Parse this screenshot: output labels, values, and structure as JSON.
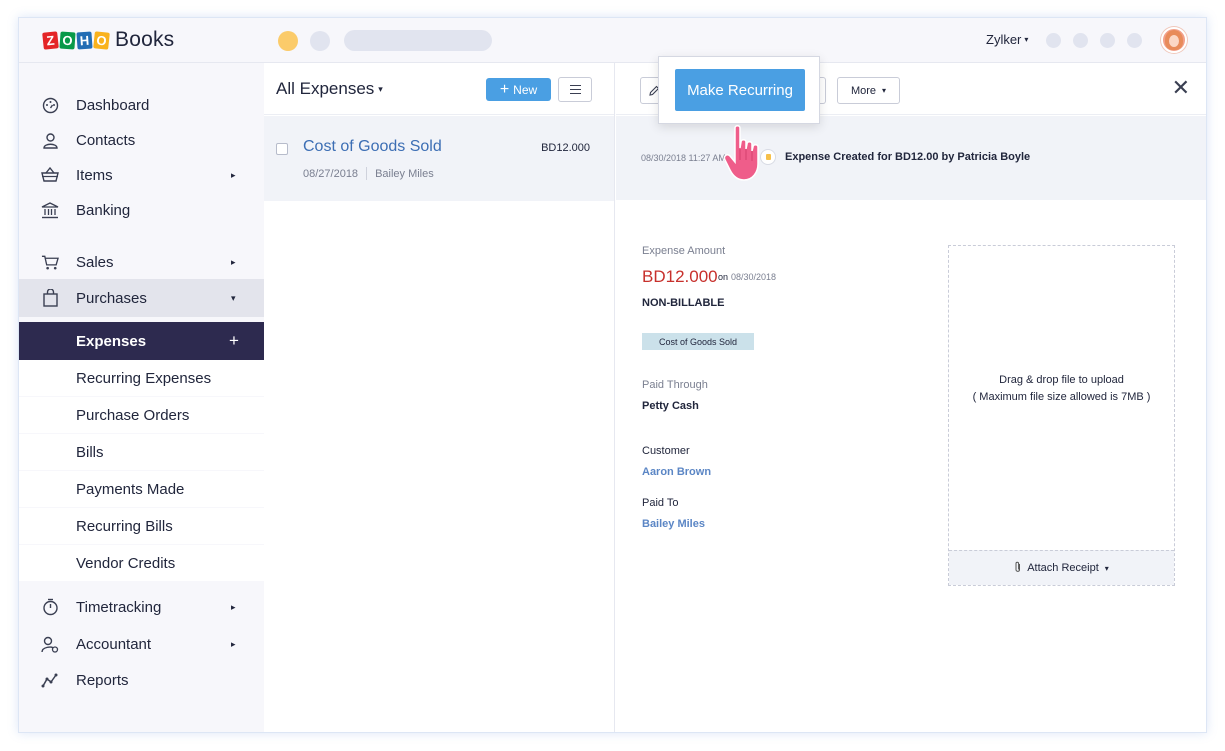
{
  "app": {
    "brand_tiles": [
      "Z",
      "O",
      "H",
      "O"
    ],
    "brand_name": "Books",
    "org_name": "Zylker",
    "org_caret": "▾"
  },
  "sidebar": {
    "items": [
      {
        "label": "Dashboard",
        "icon": "dashboard-icon"
      },
      {
        "label": "Contacts",
        "icon": "contacts-icon"
      },
      {
        "label": "Items",
        "icon": "items-basket-icon",
        "arrow": "▸"
      },
      {
        "label": "Banking",
        "icon": "bank-icon"
      },
      {
        "label": "Sales",
        "icon": "cart-icon",
        "arrow": "▸"
      },
      {
        "label": "Purchases",
        "icon": "shopping-bag-icon",
        "arrow": "▾"
      },
      {
        "label": "Timetracking",
        "icon": "stopwatch-icon",
        "arrow": "▸"
      },
      {
        "label": "Accountant",
        "icon": "accountant-icon",
        "arrow": "▸"
      },
      {
        "label": "Reports",
        "icon": "reports-icon"
      }
    ],
    "purchases_sub": [
      {
        "label": "Expenses",
        "plus": "+"
      },
      {
        "label": "Recurring Expenses"
      },
      {
        "label": "Purchase Orders"
      },
      {
        "label": "Bills"
      },
      {
        "label": "Payments Made"
      },
      {
        "label": "Recurring Bills"
      },
      {
        "label": "Vendor Credits"
      }
    ]
  },
  "list": {
    "title": "All Expenses",
    "caret": "▾",
    "new_label": "New",
    "new_plus": "+",
    "rows": [
      {
        "title": "Cost of Goods Sold",
        "amount": "BD12.000",
        "date": "08/27/2018",
        "vendor": "Bailey Miles"
      }
    ]
  },
  "detail": {
    "more_label": "More",
    "more_caret": "▾",
    "close": "✕",
    "history": {
      "time": "08/30/2018 11:27 AM",
      "message": "Expense Created for BD12.00 by Patricia Boyle"
    },
    "expense_amount_label": "Expense Amount",
    "amount": "BD12.000",
    "on_label": "on",
    "amount_date": "08/30/2018",
    "billable": "NON-BILLABLE",
    "account_tag": "Cost of Goods Sold",
    "paid_through_label": "Paid Through",
    "paid_through": "Petty Cash",
    "customer_label": "Customer",
    "customer": "Aaron Brown",
    "paid_to_label": "Paid To",
    "paid_to": "Bailey Miles",
    "dropzone_line1": "Drag & drop file to upload",
    "dropzone_line2": "( Maximum file size allowed is 7MB )",
    "attach_label": "Attach Receipt",
    "attach_caret": "▾"
  },
  "popover": {
    "button_label": "Make Recurring"
  },
  "colors": {
    "accent": "#4a9fe3",
    "nav_selected": "#2d2a4f",
    "amount_red": "#c7302c",
    "link_blue": "#5b86c5",
    "cursor_pink": "#ef5d8a"
  }
}
